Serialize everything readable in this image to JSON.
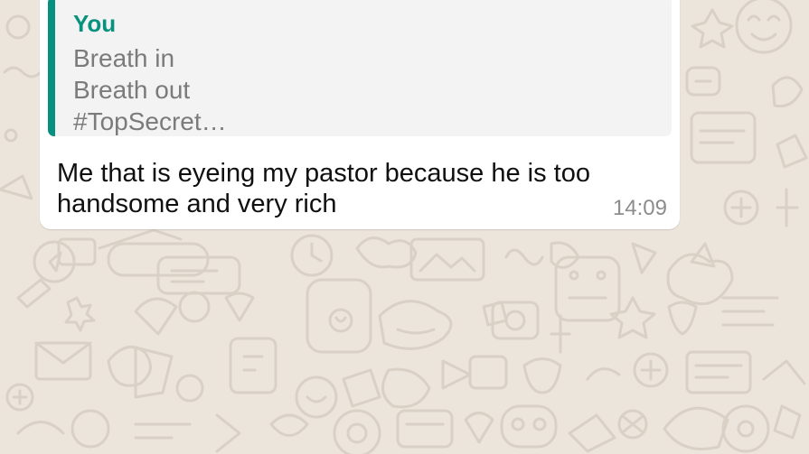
{
  "chat": {
    "background_color": "#ece5dc",
    "message": {
      "quoted": {
        "author": "You",
        "lines": [
          "Breath in",
          "Breath out",
          "#TopSecret…"
        ],
        "accent_color": "#06907f"
      },
      "text": "Me that is eyeing my pastor because he is too handsome and very rich",
      "time": "14:09"
    }
  }
}
